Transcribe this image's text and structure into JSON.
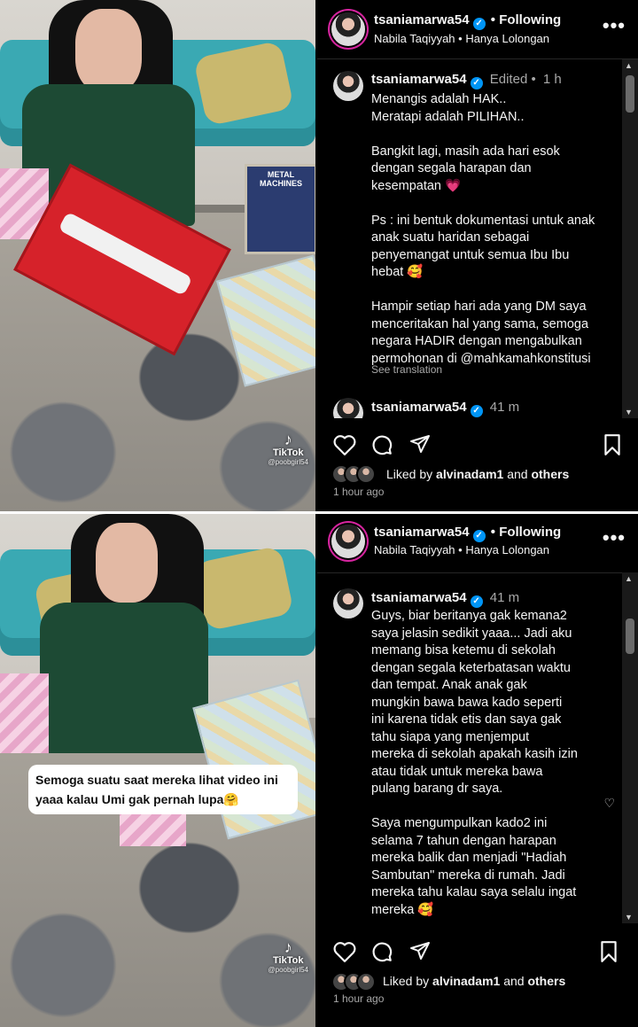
{
  "top": {
    "video": {
      "tiktok": "TikTok",
      "tiktok_user": "@poobgirl54"
    },
    "post": {
      "username": "tsaniamarwa54",
      "following": "Following",
      "subtitle": "Nabila Taqiyyah • Hanya Lolongan",
      "comment": {
        "username": "tsaniamarwa54",
        "edited": "Edited •",
        "time": "1 h",
        "text": "Menangis adalah HAK..\nMeratapi adalah PILIHAN..\n\nBangkit lagi, masih ada hari esok\ndengan segala harapan dan\nkesempatan 💗\n\nPs : ini bentuk dokumentasi untuk anak\nanak suatu haridan sebagai\npenyemangat untuk semua Ibu Ibu\nhebat 🥰\n\nHampir setiap hari ada yang DM saya\nmenceritakan hal yang sama, semoga\nnegara HADIR dengan mengabulkan\npermohonan di @mahkamahkonstitusi",
        "see_translation": "See translation"
      },
      "next_comment": {
        "username": "tsaniamarwa54",
        "time": "41 m"
      },
      "liked_by": "Liked by",
      "liked_user": "alvinadam1",
      "liked_and": "and",
      "liked_others": "others",
      "timestamp": "1 hour ago"
    }
  },
  "bottom": {
    "video": {
      "caption": "Semoga suatu saat mereka lihat video ini yaaa kalau Umi gak pernah lupa🤗",
      "tiktok": "TikTok",
      "tiktok_user": "@poobgirl54"
    },
    "post": {
      "username": "tsaniamarwa54",
      "following": "Following",
      "subtitle": "Nabila Taqiyyah • Hanya Lolongan",
      "comment": {
        "username": "tsaniamarwa54",
        "time": "41 m",
        "text": "Guys, biar beritanya gak kemana2\nsaya jelasin sedikit yaaa... Jadi aku\nmemang bisa ketemu di sekolah\ndengan segala keterbatasan waktu\ndan tempat. Anak anak gak\nmungkin bawa bawa kado seperti\nini karena tidak etis dan saya gak\ntahu siapa yang menjemput\nmereka di sekolah apakah kasih izin\natau tidak untuk mereka bawa\npulang barang dr saya.\n\nSaya mengumpulkan kado2 ini\nselama 7 tahun dengan harapan\nmereka balik dan menjadi \"Hadiah\nSambutan\" mereka di rumah. Jadi\nmereka tahu kalau saya selalu ingat\nmereka 🥰"
      },
      "liked_by": "Liked by",
      "liked_user": "alvinadam1",
      "liked_and": "and",
      "liked_others": "others",
      "timestamp": "1 hour ago"
    }
  },
  "colors": {
    "background": "#000000",
    "verified": "#0095f6",
    "muted": "#a8a8a8",
    "story_ring": "#d6249f"
  },
  "icons": [
    "heart-icon",
    "comment-icon",
    "share-icon",
    "bookmark-icon",
    "more-icon",
    "verified-icon",
    "tiktok-icon"
  ]
}
